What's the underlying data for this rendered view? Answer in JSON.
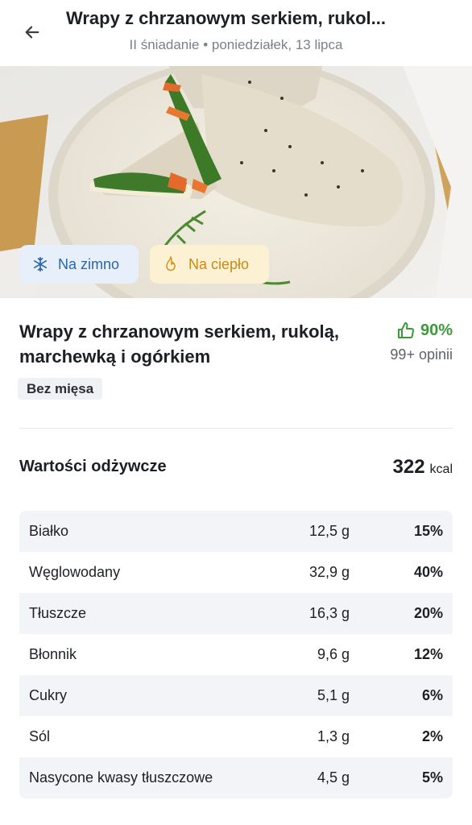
{
  "header": {
    "title": "Wrapy z chrzanowym serkiem, rukol...",
    "subtitle": "II śniadanie • poniedziałek, 13 lipca"
  },
  "chips": {
    "cold": "Na zimno",
    "warm": "Na ciepło"
  },
  "recipe": {
    "title": "Wrapy z chrzanowym serkiem, rukolą, marchewką i ogórkiem",
    "rating_pct": "90%",
    "rating_count": "99+ opinii",
    "tag": "Bez mięsa"
  },
  "nutrition": {
    "heading": "Wartości odżywcze",
    "kcal_value": "322",
    "kcal_unit": "kcal",
    "rows": [
      {
        "name": "Białko",
        "amount": "12,5 g",
        "pct": "15%"
      },
      {
        "name": "Węglowodany",
        "amount": "32,9 g",
        "pct": "40%"
      },
      {
        "name": "Tłuszcze",
        "amount": "16,3 g",
        "pct": "20%"
      },
      {
        "name": "Błonnik",
        "amount": "9,6 g",
        "pct": "12%"
      },
      {
        "name": "Cukry",
        "amount": "5,1 g",
        "pct": "6%"
      },
      {
        "name": "Sól",
        "amount": "1,3 g",
        "pct": "2%"
      },
      {
        "name": "Nasycone kwasy tłuszczowe",
        "amount": "4,5 g",
        "pct": "5%"
      }
    ]
  },
  "colors": {
    "accent_green": "#3c9a3a",
    "cold_chip_bg": "#e6effa",
    "cold_chip_text": "#2b66a8",
    "warm_chip_bg": "#fdf1d4",
    "warm_chip_text": "#c88a16"
  },
  "icons": {
    "back": "arrow-left-icon",
    "cold": "snowflake-icon",
    "warm": "flame-icon",
    "rating": "thumbs-up-icon"
  }
}
